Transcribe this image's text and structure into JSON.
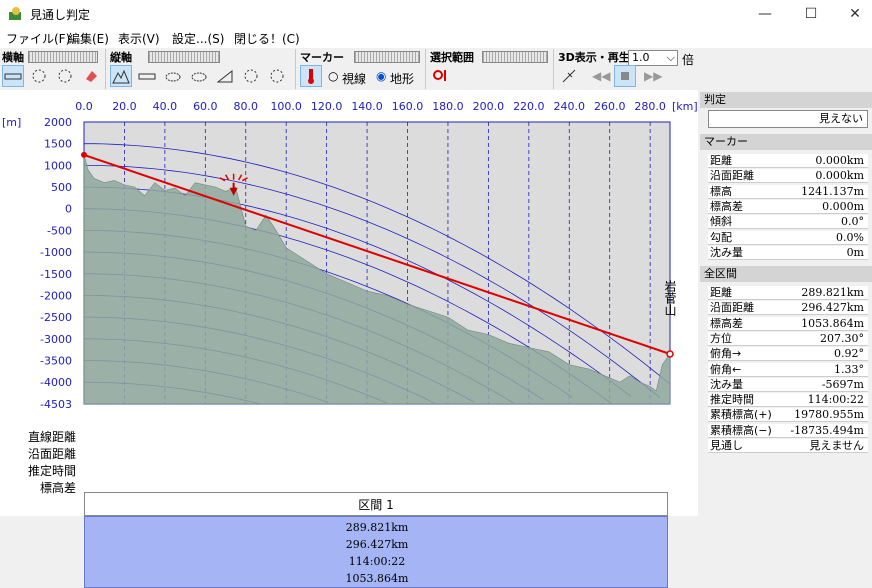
{
  "window": {
    "title": "見通し判定",
    "minimize": "—",
    "maximize": "☐",
    "close": "✕"
  },
  "menu": [
    "ファイル(F)",
    "編集(E)",
    "表示(V)",
    "設定...(S)",
    "閉じる！(C)"
  ],
  "toolbar": {
    "h_axis": "横軸",
    "v_axis": "縦軸",
    "marker": "マーカー",
    "range": "選択範囲",
    "play": "3D表示・再生",
    "zoom": "1.0",
    "zoom_unit": "倍",
    "radio_sight": "視線",
    "radio_terrain": "地形"
  },
  "chart_data": {
    "type": "area",
    "x_unit": "[km]",
    "y_unit": "[m]",
    "xticks": [
      "0.0",
      "20.0",
      "40.0",
      "60.0",
      "80.0",
      "100.0",
      "120.0",
      "140.0",
      "160.0",
      "180.0",
      "200.0",
      "220.0",
      "240.0",
      "260.0",
      "280.0"
    ],
    "yticks": [
      "2000",
      "1500",
      "1000",
      "500",
      "0",
      "-500",
      "-1000",
      "-1500",
      "-2000",
      "-2500",
      "-3000",
      "-3500",
      "-4000",
      "-4503"
    ],
    "xlim": [
      0,
      289.821
    ],
    "ylim": [
      -4503,
      2000
    ],
    "sightline": {
      "x": [
        0,
        289.821
      ],
      "y": [
        1241,
        -3350
      ]
    },
    "end_label": "岩菅山",
    "terrain": {
      "x": [
        0,
        2,
        5,
        10,
        15,
        20,
        25,
        30,
        35,
        40,
        45,
        50,
        55,
        60,
        65,
        70,
        75,
        80,
        85,
        90,
        95,
        100,
        110,
        120,
        130,
        140,
        150,
        160,
        170,
        180,
        190,
        200,
        210,
        220,
        230,
        240,
        250,
        260,
        265,
        270,
        275,
        280,
        283,
        286,
        289.821
      ],
      "y": [
        1241,
        900,
        700,
        600,
        650,
        550,
        500,
        300,
        600,
        420,
        480,
        300,
        600,
        550,
        500,
        400,
        500,
        -400,
        -500,
        -150,
        -500,
        -900,
        -1200,
        -1500,
        -1700,
        -1900,
        -2000,
        -2200,
        -2350,
        -2500,
        -2800,
        -2900,
        -3100,
        -3200,
        -3300,
        -3600,
        -3700,
        -3900,
        -4000,
        -3850,
        -4000,
        -4100,
        -4200,
        -3600,
        -3350
      ]
    }
  },
  "section": {
    "header": "区間 1",
    "labels": [
      "直線距離",
      "沿面距離",
      "推定時間",
      "標高差"
    ],
    "values": [
      "289.821km",
      "296.427km",
      "114:00:22",
      "1053.864m"
    ]
  },
  "sidebar": {
    "judge_hdr": "判定",
    "judge_val": "見えない",
    "marker_hdr": "マーカー",
    "marker_rows": [
      [
        "距離",
        "0.000km"
      ],
      [
        "沿面距離",
        "0.000km"
      ],
      [
        "標高",
        "1241.137m"
      ],
      [
        "標高差",
        "0.000m"
      ],
      [
        "傾斜",
        "0.0°"
      ],
      [
        "勾配",
        "0.0%"
      ],
      [
        "沈み量",
        "0m"
      ]
    ],
    "all_hdr": "全区間",
    "all_rows": [
      [
        "距離",
        "289.821km"
      ],
      [
        "沿面距離",
        "296.427km"
      ],
      [
        "標高差",
        "1053.864m"
      ],
      [
        "方位",
        "207.30°"
      ],
      [
        "俯角→",
        "0.92°"
      ],
      [
        "俯角←",
        "1.33°"
      ],
      [
        "沈み量",
        "-5697m"
      ],
      [
        "推定時間",
        "114:00:22"
      ],
      [
        "累積標高(+)",
        "19780.955m"
      ],
      [
        "累積標高(−)",
        "-18735.494m"
      ],
      [
        "見通し",
        "見えません"
      ]
    ]
  }
}
